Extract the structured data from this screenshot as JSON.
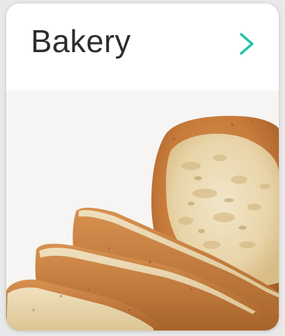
{
  "card": {
    "title": "Bakery",
    "chevron_icon": "chevron-right-icon",
    "image_subject": "bread-loaf-image",
    "accent_color": "#20c4a8"
  }
}
